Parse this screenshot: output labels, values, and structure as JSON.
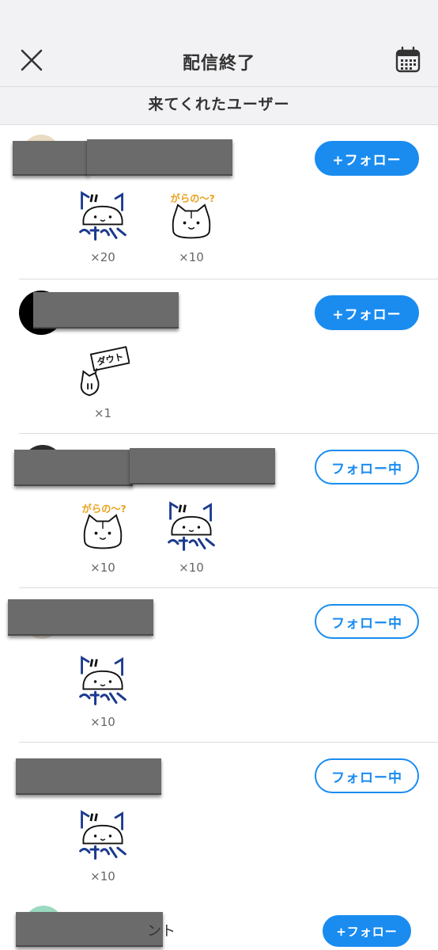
{
  "nav": {
    "title": "配信終了",
    "close_icon": "close-icon",
    "calendar_icon": "calendar-icon"
  },
  "section": {
    "title": "来てくれたユーザー"
  },
  "colors": {
    "accent": "#1a8cf0",
    "redaction": "#6b6b6b"
  },
  "users": [
    {
      "follow_label": "+フォロー",
      "follow_state": "not-following",
      "stamps": [
        {
          "type": "blue-cat-stamp",
          "count": "×20"
        },
        {
          "type": "orange-cat-stamp",
          "count": "×10"
        }
      ]
    },
    {
      "follow_label": "+フォロー",
      "follow_state": "not-following",
      "stamps": [
        {
          "type": "sign-cat-stamp",
          "count": "×1",
          "sign_text": "ダウト"
        }
      ]
    },
    {
      "follow_label": "フォロー中",
      "follow_state": "following",
      "stamps": [
        {
          "type": "orange-cat-stamp",
          "count": "×10"
        },
        {
          "type": "blue-cat-stamp",
          "count": "×10"
        }
      ]
    },
    {
      "follow_label": "フォロー中",
      "follow_state": "following",
      "stamps": [
        {
          "type": "blue-cat-stamp",
          "count": "×10"
        }
      ]
    },
    {
      "follow_label": "フォロー中",
      "follow_state": "following",
      "stamps": [
        {
          "type": "blue-cat-stamp",
          "count": "×10"
        }
      ]
    }
  ],
  "last_user": {
    "name_fragment": "ント",
    "follow_label": "+フォロー"
  },
  "stamp_texts": {
    "orange_caption": "がらの〜?"
  }
}
